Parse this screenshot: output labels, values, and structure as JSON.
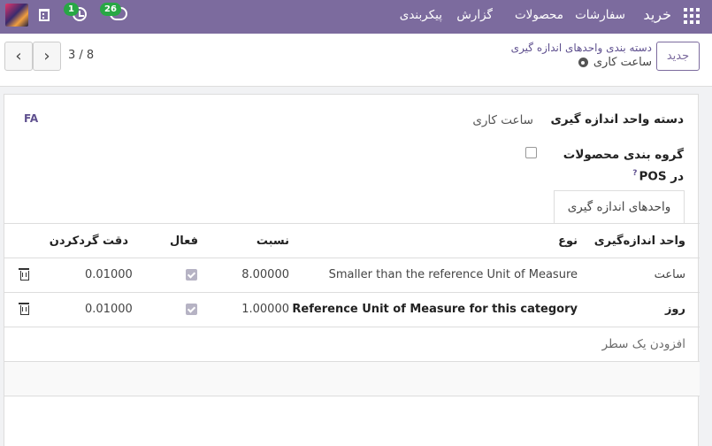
{
  "navbar": {
    "brand": "خرید",
    "menu": [
      "سفارشات",
      "محصولات",
      "گزارش",
      "پیکربندی"
    ],
    "activity_badge": "1",
    "messages_badge": "26"
  },
  "control": {
    "new_label": "جدید",
    "breadcrumb": "دسته بندی واحدهای اندازه گیری",
    "record_title": "ساعت کاری",
    "pager_value": "3 / 8"
  },
  "form": {
    "lang": "FA",
    "category_label": "دسته واحد اندازه گیری",
    "category_value": "ساعت کاری",
    "pos_label": "گروه بندی محصولات در POS",
    "pos_help": "?",
    "pos_checked": false,
    "tab_label": "واحدهای اندازه گیری"
  },
  "table": {
    "headers": {
      "uom": "واحد اندازه‌گیری",
      "type": "نوع",
      "ratio": "نسبت",
      "active": "فعال",
      "rounding": "دقت گردکردن"
    },
    "rows": [
      {
        "uom": "ساعت",
        "type": "Smaller than the reference Unit of Measure",
        "ratio": "8.00000",
        "active": true,
        "rounding": "0.01000"
      },
      {
        "uom": "روز",
        "type": "Reference Unit of Measure for this category",
        "ratio": "1.00000",
        "active": true,
        "rounding": "0.01000"
      }
    ],
    "add_line": "افزودن یک سطر"
  },
  "colors": {
    "brand": "#7c6b9e",
    "badge": "#28a745"
  },
  "icons": [
    "apps-grid-icon",
    "building-icon",
    "clock-icon",
    "chat-icon",
    "gear-icon",
    "trash-icon",
    "chevron-left-icon",
    "chevron-right-icon"
  ]
}
